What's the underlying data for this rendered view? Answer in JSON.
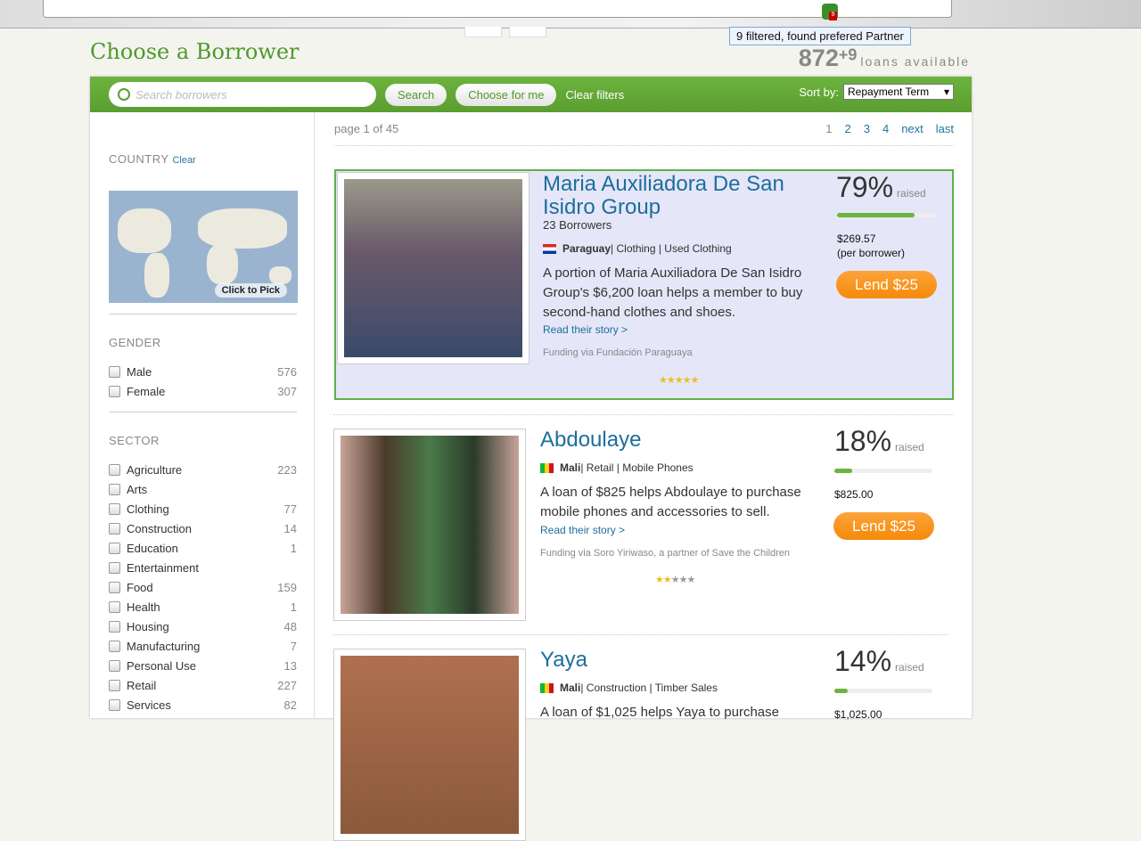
{
  "browser": {
    "tooltip": "9 filtered, found prefered Partner",
    "badge": "9"
  },
  "header": {
    "title": "Choose a Borrower",
    "loan_count": "872",
    "loan_extra": "+9",
    "loans_label": "loans available"
  },
  "toolbar": {
    "search_placeholder": "Search borrowers",
    "search": "Search",
    "choose": "Choose for me",
    "clear": "Clear filters",
    "sort_label": "Sort by:",
    "sort_value": "Repayment Term"
  },
  "sidebar": {
    "country": "COUNTRY",
    "country_clear": "Clear",
    "map_label": "Click to Pick",
    "gender": "GENDER",
    "genders": [
      {
        "label": "Male",
        "count": "576"
      },
      {
        "label": "Female",
        "count": "307"
      }
    ],
    "sector": "SECTOR",
    "sectors": [
      {
        "label": "Agriculture",
        "count": "223"
      },
      {
        "label": "Arts",
        "count": ""
      },
      {
        "label": "Clothing",
        "count": "77"
      },
      {
        "label": "Construction",
        "count": "14"
      },
      {
        "label": "Education",
        "count": "1"
      },
      {
        "label": "Entertainment",
        "count": ""
      },
      {
        "label": "Food",
        "count": "159"
      },
      {
        "label": "Health",
        "count": "1"
      },
      {
        "label": "Housing",
        "count": "48"
      },
      {
        "label": "Manufacturing",
        "count": "7"
      },
      {
        "label": "Personal Use",
        "count": "13"
      },
      {
        "label": "Retail",
        "count": "227"
      },
      {
        "label": "Services",
        "count": "82"
      }
    ]
  },
  "pager": {
    "info": "page 1 of 45",
    "pages": [
      "1",
      "2",
      "3",
      "4"
    ],
    "next": "next",
    "last": "last"
  },
  "loans": [
    {
      "name": "Maria Auxiliadora De San Isidro Group",
      "borrowers": "23 Borrowers",
      "country": "Paraguay",
      "sector": " | Clothing | Used Clothing",
      "desc": "A portion of Maria Auxiliadora De San Isidro Group's $6,200 loan helps a member to buy second-hand clothes and shoes.",
      "story": "Read their story >",
      "via": "Funding via Fundación Paraguaya",
      "rating": 4.5,
      "percent": "79%",
      "percent_value": 79,
      "raised": "raised",
      "amount": "$269.57",
      "amount_note": "(per borrower)",
      "lend": "Lend $25"
    },
    {
      "name": "Abdoulaye",
      "country": "Mali",
      "sector": " | Retail | Mobile Phones",
      "desc": "A loan of $825 helps Abdoulaye to purchase mobile phones and accessories to sell.",
      "story": "Read their story >",
      "via": "Funding via Soro Yiriwaso, a partner of Save the Children",
      "rating": 2,
      "percent": "18%",
      "percent_value": 18,
      "raised": "raised",
      "amount": "$825.00",
      "lend": "Lend $25"
    },
    {
      "name": "Yaya",
      "country": "Mali",
      "sector": " | Construction | Timber Sales",
      "desc": "A loan of $1,025 helps Yaya to purchase",
      "percent": "14%",
      "percent_value": 14,
      "raised": "raised",
      "amount": "$1,025.00"
    }
  ]
}
